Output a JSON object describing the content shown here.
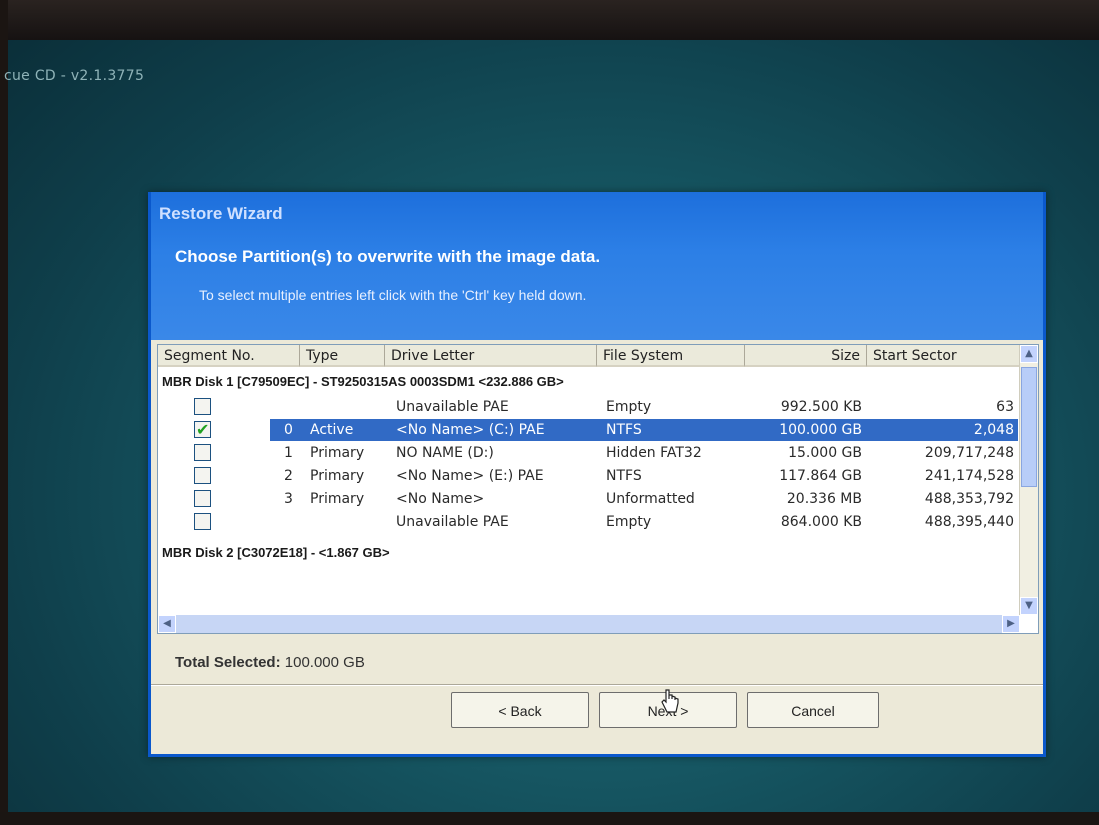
{
  "app": {
    "title": "cue CD - v2.1.3775"
  },
  "wizard": {
    "title": "Restore Wizard",
    "heading": "Choose  Partition(s)  to overwrite with the image data.",
    "instruction": "To select multiple entries left click with the 'Ctrl' key held down."
  },
  "table": {
    "columns": [
      "Segment No.",
      "Type",
      "Drive Letter",
      "File System",
      "Size",
      "Start Sector"
    ],
    "disk1_label": "MBR Disk 1 [C79509EC] - ST9250315AS 0003SDM1  <232.886 GB>",
    "rows": [
      {
        "checked": false,
        "num": "",
        "type": "",
        "drive": "Unavailable  PAE",
        "fs": "Empty",
        "size": "992.500 KB",
        "start": "63"
      },
      {
        "checked": true,
        "num": "0",
        "type": "Active",
        "drive": "<No Name> (C:)  PAE",
        "fs": "NTFS",
        "size": "100.000 GB",
        "start": "2,048"
      },
      {
        "checked": false,
        "num": "1",
        "type": "Primary",
        "drive": "NO NAME (D:)",
        "fs": "Hidden FAT32",
        "size": "15.000 GB",
        "start": "209,717,248"
      },
      {
        "checked": false,
        "num": "2",
        "type": "Primary",
        "drive": "<No Name> (E:)  PAE",
        "fs": "NTFS",
        "size": "117.864 GB",
        "start": "241,174,528"
      },
      {
        "checked": false,
        "num": "3",
        "type": "Primary",
        "drive": "<No Name>",
        "fs": "Unformatted",
        "size": "20.336 MB",
        "start": "488,353,792"
      },
      {
        "checked": false,
        "num": "",
        "type": "",
        "drive": "Unavailable  PAE",
        "fs": "Empty",
        "size": "864.000 KB",
        "start": "488,395,440"
      }
    ],
    "disk2_label": "MBR Disk 2 [C3072E18] -  <1.867 GB>"
  },
  "total": {
    "label": "Total Selected:",
    "value": "100.000 GB"
  },
  "buttons": {
    "back": "< Back",
    "next": "Next >",
    "cancel": "Cancel"
  },
  "icons": {
    "up": "chevron-up-icon",
    "down": "chevron-down-icon",
    "left": "chevron-left-icon",
    "right": "chevron-right-icon",
    "check": "check-mark-icon",
    "cursor": "hand-pointer-icon"
  },
  "colors": {
    "header": "#2c7fe6",
    "selection": "#316ac5",
    "dialog_bg": "#ece9d8"
  }
}
